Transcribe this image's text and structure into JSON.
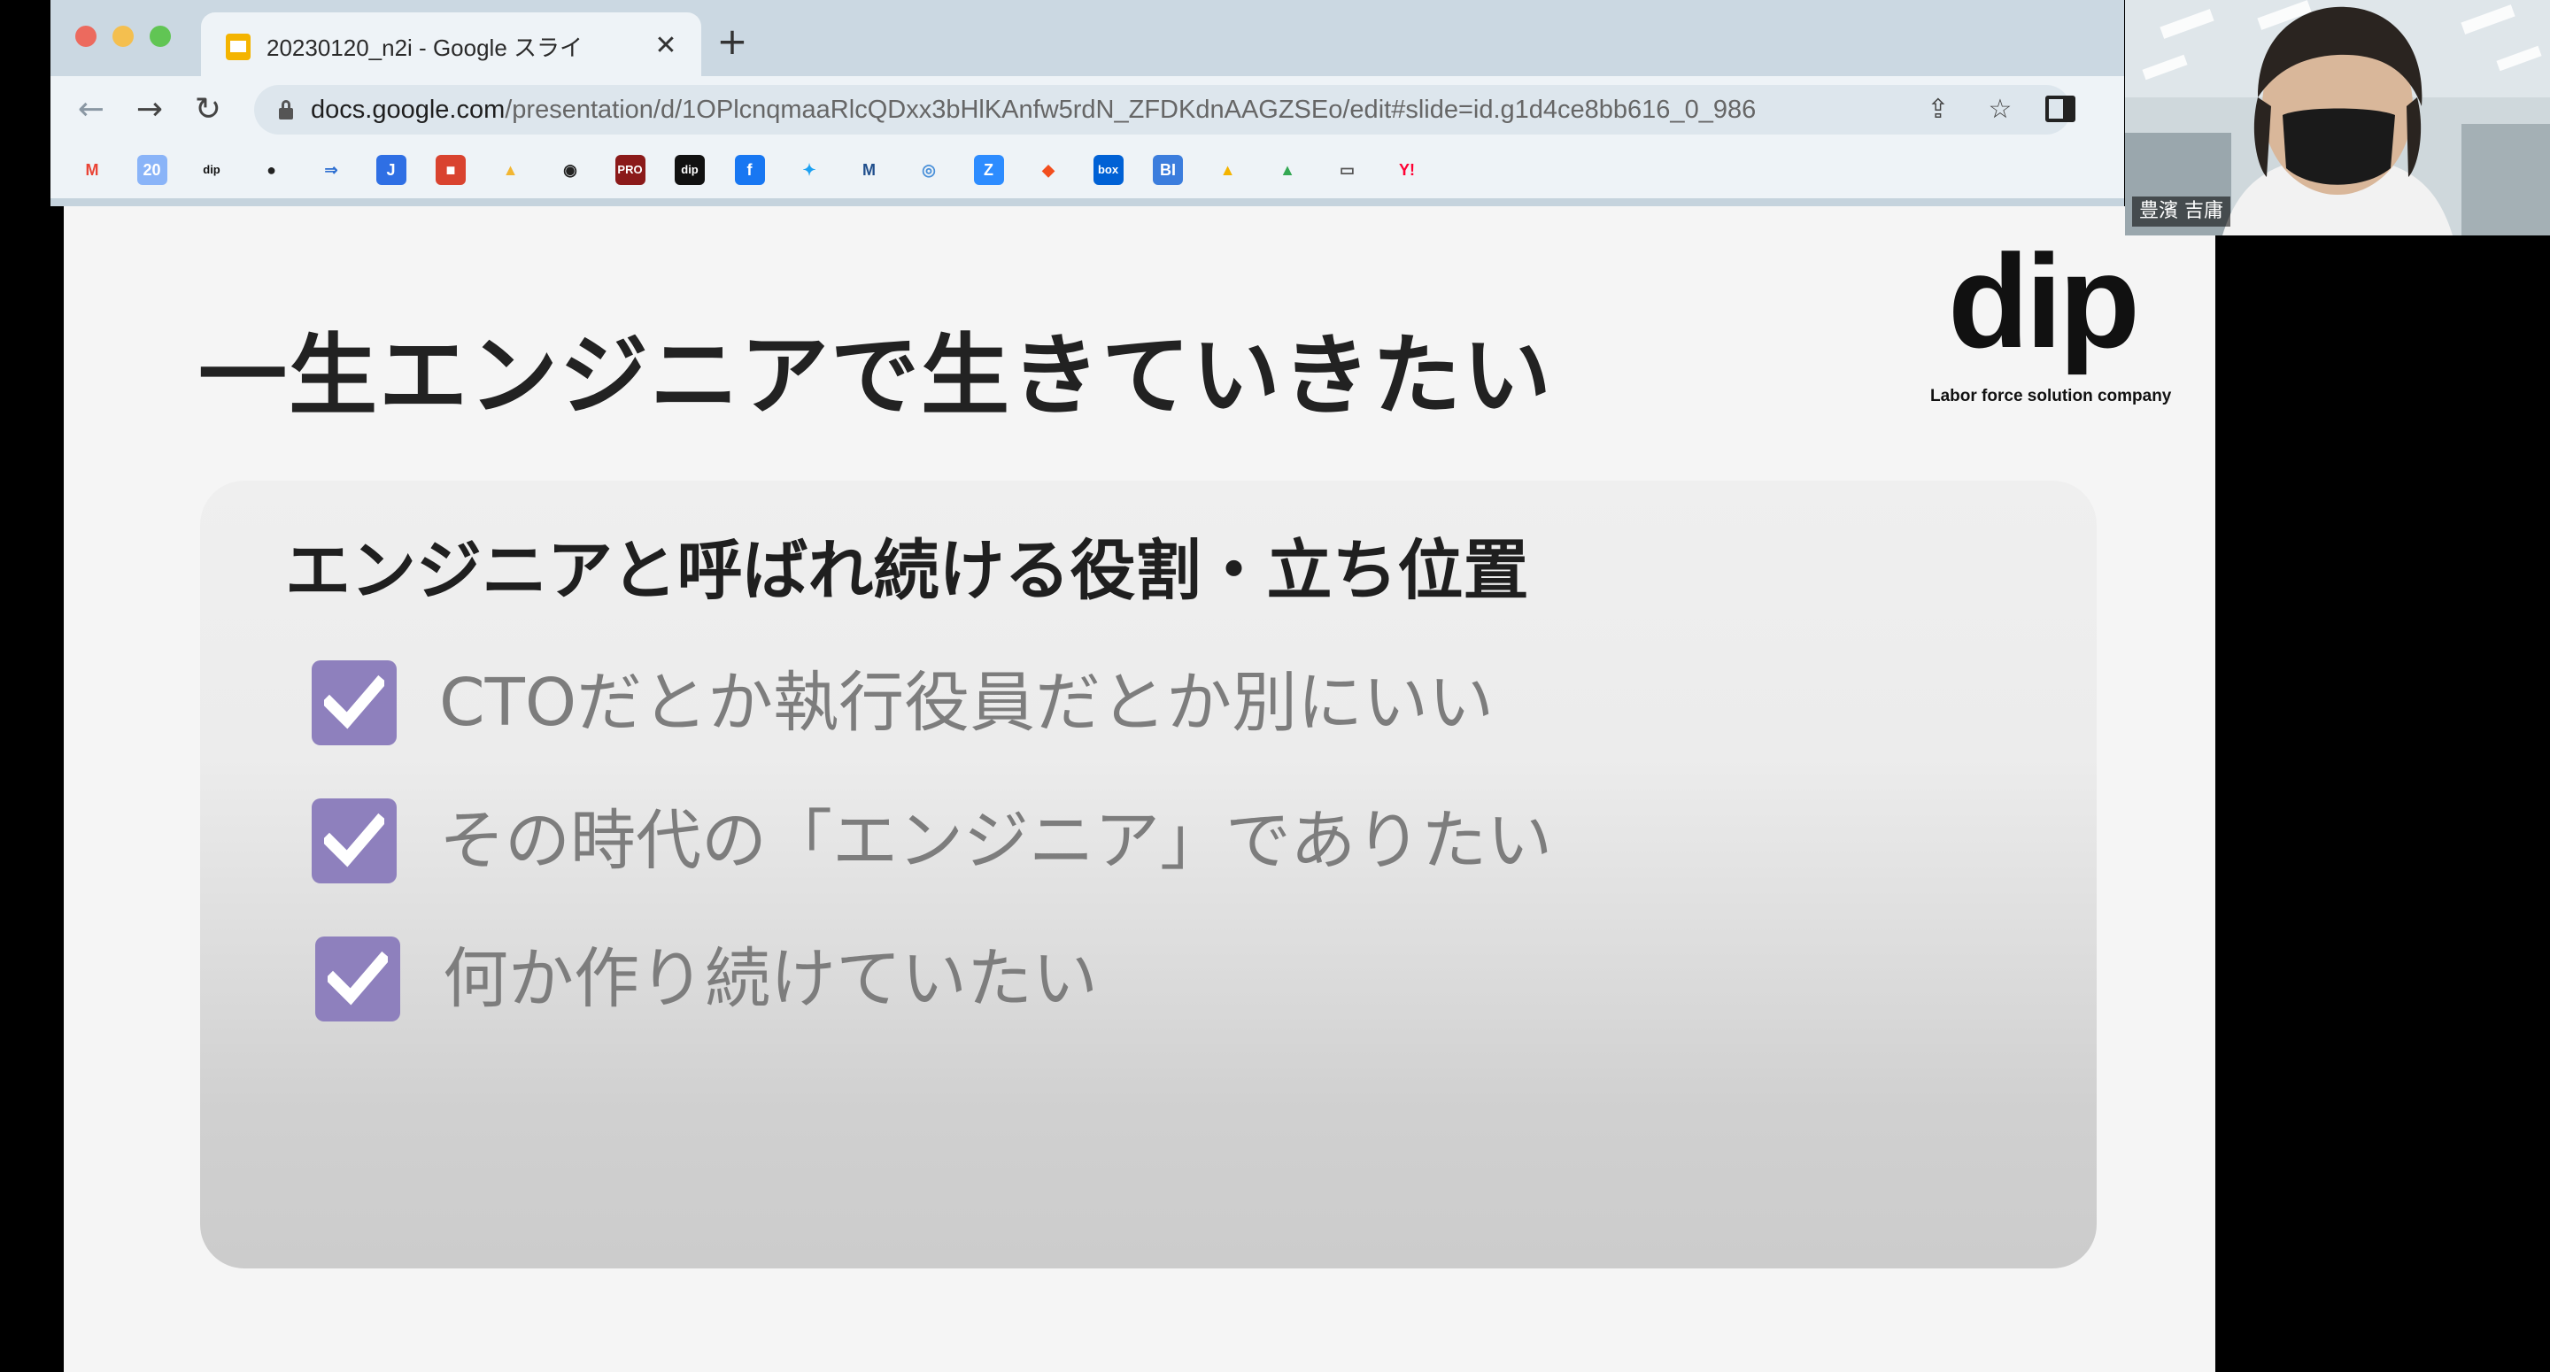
{
  "browser": {
    "tab_title": "20230120_n2i - Google スライ",
    "tab_close": "✕",
    "new_tab": "+",
    "url_host": "docs.google.com",
    "url_path": "/presentation/d/1OPlcnqmaaRlcQDxx3bHlKAnfw5rdN_ZFDKdnAAGZSEo/edit#slide=id.g1d4ce8bb616_0_986",
    "nav": {
      "back": "←",
      "forward": "→",
      "reload": "↻"
    },
    "share_icon": "⇪",
    "star_icon": "☆",
    "bookmarks": [
      {
        "name": "gmail-bookmark",
        "text": "M",
        "color": "#ea4335",
        "bg": "#eef3f7"
      },
      {
        "name": "calendar-bookmark",
        "text": "20",
        "color": "#ffffff",
        "bg": "#8ab4f8"
      },
      {
        "name": "dip-portal-bookmark",
        "text": "dip",
        "color": "#111111",
        "bg": "#eef3f7"
      },
      {
        "name": "globe-bookmark",
        "text": "●",
        "color": "#222222",
        "bg": "#eef3f7"
      },
      {
        "name": "arrow-bookmark",
        "text": "⇒",
        "color": "#2e6fd1",
        "bg": "#eef3f7"
      },
      {
        "name": "jira-bookmark",
        "text": "J",
        "color": "#ffffff",
        "bg": "#2f6fe4"
      },
      {
        "name": "red-app-bookmark",
        "text": "■",
        "color": "#ffffff",
        "bg": "#d9432f"
      },
      {
        "name": "cat-bookmark",
        "text": "▲",
        "color": "#f2b632",
        "bg": "#eef3f7"
      },
      {
        "name": "panda-bookmark",
        "text": "◉",
        "color": "#222222",
        "bg": "#eef3f7"
      },
      {
        "name": "pro-bookmark",
        "text": "PRO",
        "color": "#ffffff",
        "bg": "#8b1a1a"
      },
      {
        "name": "dip-bookmark",
        "text": "dip",
        "color": "#ffffff",
        "bg": "#111111"
      },
      {
        "name": "facebook-bookmark",
        "text": "f",
        "color": "#ffffff",
        "bg": "#1877f2"
      },
      {
        "name": "twitter-bookmark",
        "text": "✦",
        "color": "#1da1f2",
        "bg": "#eef3f7"
      },
      {
        "name": "m-bookmark",
        "text": "M",
        "color": "#1f4e8c",
        "bg": "#eef3f7"
      },
      {
        "name": "blue-circle-bookmark",
        "text": "◎",
        "color": "#4a90d9",
        "bg": "#eef3f7"
      },
      {
        "name": "zoom-bookmark",
        "text": "Z",
        "color": "#ffffff",
        "bg": "#2d8cff"
      },
      {
        "name": "figma-bookmark",
        "text": "◆",
        "color": "#f24e1e",
        "bg": "#eef3f7"
      },
      {
        "name": "box-bookmark",
        "text": "box",
        "color": "#ffffff",
        "bg": "#0061d5"
      },
      {
        "name": "bi-bookmark",
        "text": "BI",
        "color": "#ffffff",
        "bg": "#3b7ddd"
      },
      {
        "name": "drive-shared-bookmark",
        "text": "▲",
        "color": "#f4b400",
        "bg": "#eef3f7"
      },
      {
        "name": "drive-bookmark",
        "text": "▲",
        "color": "#34a853",
        "bg": "#eef3f7"
      },
      {
        "name": "folder-bookmark",
        "text": "▭",
        "color": "#555555",
        "bg": "#eef3f7"
      },
      {
        "name": "yahoo-bookmark",
        "text": "Y!",
        "color": "#ff0033",
        "bg": "#eef3f7"
      }
    ]
  },
  "slide": {
    "title": "一生エンジニアで生きていきたい",
    "logo_word": "dip",
    "logo_tagline": "Labor force solution company",
    "card": {
      "heading": "エンジニアと呼ばれ続ける役割・立ち位置",
      "items": [
        "CTOだとか執行役員だとか別にいい",
        "その時代の「エンジニア」でありたい",
        "何か作り続けていたい"
      ]
    }
  },
  "webcam": {
    "participant_name": "豊濱 吉庸"
  },
  "colors": {
    "checkbox": "#8e80bd",
    "item_text": "#7d7d7d",
    "chrome_bg": "#eef3f7"
  }
}
